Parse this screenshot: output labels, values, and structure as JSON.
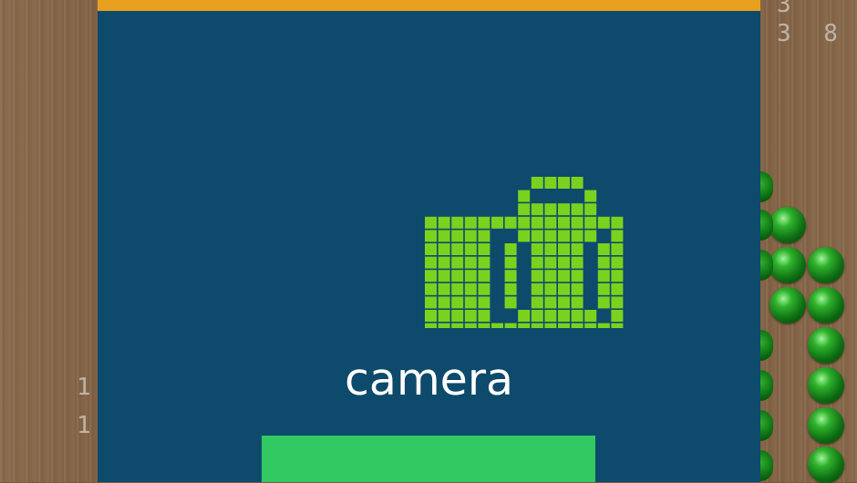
{
  "game": {
    "left_numbers": [
      "1",
      "1"
    ],
    "right_numbers": [
      "3",
      "3 8"
    ],
    "marble_color": "#1f9a20"
  },
  "dialog": {
    "background": "#0e4a6b",
    "accent_bar": "#e8a01f",
    "icon": "camera-icon",
    "icon_color": "#7ad21f",
    "title": "camera",
    "button_color": "#32c862",
    "button_label": ""
  }
}
